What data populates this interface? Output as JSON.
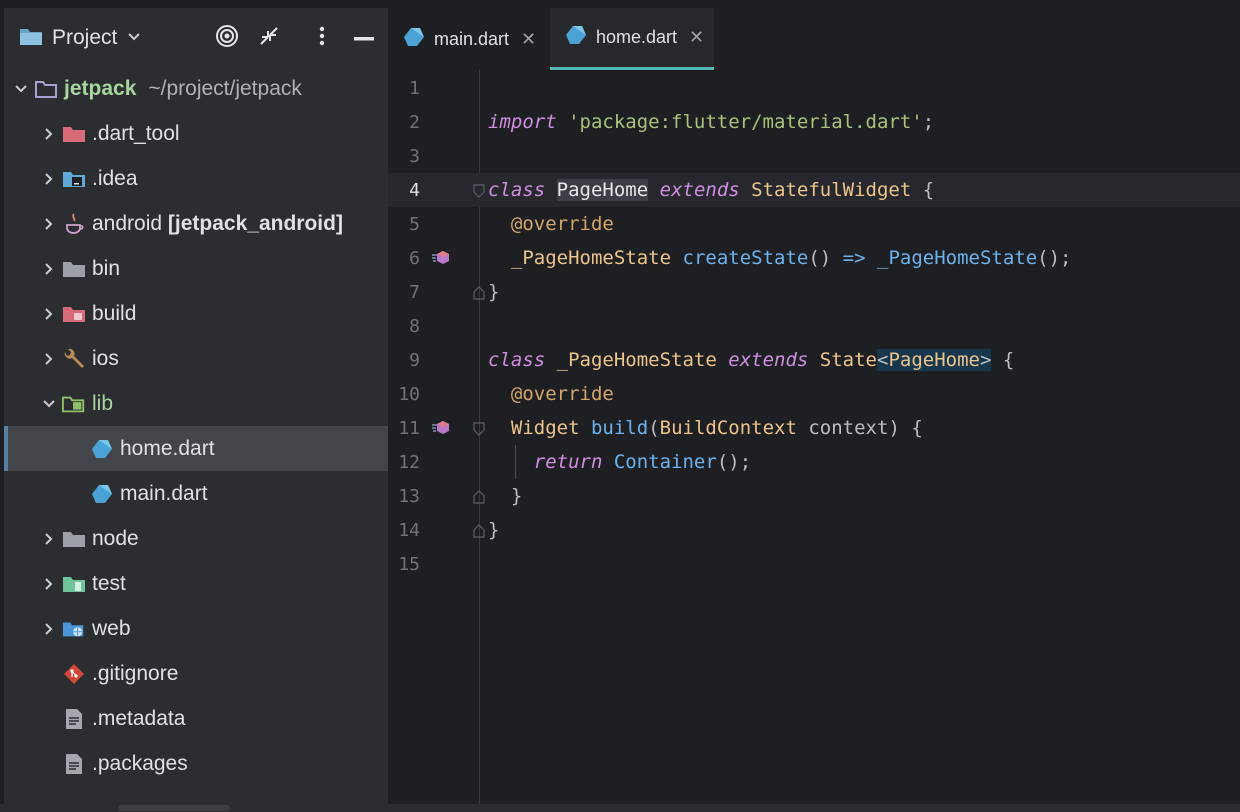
{
  "panel": {
    "title": "Project"
  },
  "tree": {
    "root": {
      "name": "jetpack",
      "path": "~/project/jetpack"
    },
    "items": [
      {
        "label": ".dart_tool"
      },
      {
        "label": ".idea"
      },
      {
        "label": "android",
        "module": "[jetpack_android]"
      },
      {
        "label": "bin"
      },
      {
        "label": "build"
      },
      {
        "label": "ios"
      },
      {
        "label": "lib"
      },
      {
        "label": "home.dart"
      },
      {
        "label": "main.dart"
      },
      {
        "label": "node"
      },
      {
        "label": "test"
      },
      {
        "label": "web"
      },
      {
        "label": ".gitignore"
      },
      {
        "label": ".metadata"
      },
      {
        "label": ".packages"
      }
    ]
  },
  "tabs": [
    {
      "label": "main.dart",
      "close": "✕"
    },
    {
      "label": "home.dart",
      "close": "✕"
    }
  ],
  "editor": {
    "line_numbers": [
      "1",
      "2",
      "3",
      "4",
      "5",
      "6",
      "7",
      "8",
      "9",
      "10",
      "11",
      "12",
      "13",
      "14",
      "15"
    ],
    "current_line": "4",
    "code": {
      "l2": {
        "kw": "import",
        "str": "'package:flutter/material.dart'",
        "end": ";"
      },
      "l4": {
        "kw1": "class",
        "name": "PageHome",
        "kw2": "extends",
        "parent": "StatefulWidget",
        "end": "{"
      },
      "l5": {
        "ann": "@override"
      },
      "l6": {
        "type": "_PageHomeState",
        "fn": "createState",
        "mid": "() ",
        "arrow": "=>",
        "ctor": "_PageHomeState",
        "end": "();"
      },
      "l7": {
        "text": "}"
      },
      "l9": {
        "kw1": "class",
        "name": "_PageHomeState",
        "kw2": "extends",
        "parent": "State",
        "lt": "<",
        "generic": "PageHome",
        "gt": ">",
        "end": " {"
      },
      "l10": {
        "ann": "@override"
      },
      "l11": {
        "type": "Widget",
        "fn": "build",
        "p1": "(",
        "ptype": "BuildContext",
        "pname": " context",
        "end": ") {"
      },
      "l12": {
        "kw": "return",
        "ctor": "Container",
        "end": "();"
      },
      "l13": {
        "text": "}"
      },
      "l14": {
        "text": "}"
      }
    }
  },
  "colors": {
    "background": "#1e1f22",
    "panel": "#2b2d30",
    "keyword": "#cf8ee0",
    "string": "#a9c27a",
    "class": "#ecc48c",
    "function": "#6cb2ee",
    "accent": "#4fb8b0"
  },
  "icons": {
    "panel": "folder-icon",
    "locate": "target-icon",
    "collapse": "collapse-icon",
    "options": "kebab-icon",
    "hide": "minimize-icon",
    "dart": "dart-file-icon",
    "git": "git-icon",
    "text": "text-file-icon"
  }
}
